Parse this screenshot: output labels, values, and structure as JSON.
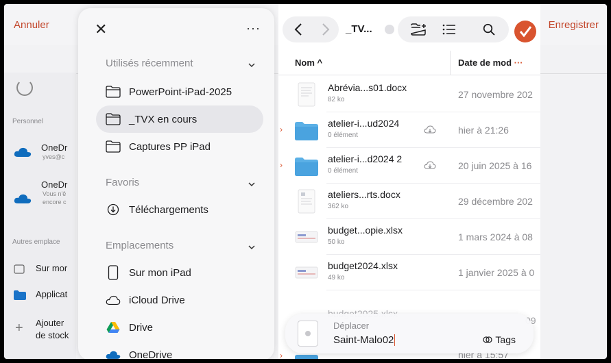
{
  "background": {
    "cancel_label": "Annuler",
    "save_label": "Enregistrer",
    "personal_section": "Personnel",
    "onedrive1_label": "OneDr",
    "onedrive1_sub": "yves@c",
    "onedrive2_label": "OneDr",
    "onedrive2_sub1": "Vous n'ê",
    "onedrive2_sub2": "encore c",
    "other_section": "Autres emplace",
    "item_ipad": "Sur mor",
    "item_applic": "Applicat",
    "item_add1": "Ajouter",
    "item_add2": "de stock"
  },
  "sidebar": {
    "more_label": "···",
    "recent_title": "Utilisés récemment",
    "recent": [
      {
        "label": "PowerPoint-iPad-2025"
      },
      {
        "label": "_TVX en cours"
      },
      {
        "label": "Captures PP iPad"
      }
    ],
    "favorites_title": "Favoris",
    "favorites": [
      {
        "label": "Téléchargements"
      }
    ],
    "locations_title": "Emplacements",
    "locations": [
      {
        "label": "Sur mon iPad"
      },
      {
        "label": "iCloud Drive"
      },
      {
        "label": "Drive"
      },
      {
        "label": "OneDrive"
      }
    ]
  },
  "toolbar": {
    "title": "_TV..."
  },
  "columns": {
    "name": "Nom",
    "date": "Date de mod",
    "dots": "···"
  },
  "files": [
    {
      "name": "Abrévia...s01.docx",
      "sub": "82 ko",
      "date": "27 novembre 202",
      "kind": "docx"
    },
    {
      "name": "atelier-i...ud2024",
      "sub": "0 élément",
      "date": "hier à 21:26",
      "kind": "folder"
    },
    {
      "name": "atelier-i...d2024 2",
      "sub": "0 élément",
      "date": "20 juin 2025 à 16",
      "kind": "folder"
    },
    {
      "name": "ateliers...rts.docx",
      "sub": "362 ko",
      "date": "29 décembre 202",
      "kind": "docx"
    },
    {
      "name": "budget...opie.xlsx",
      "sub": "50 ko",
      "date": "1 mars 2024 à 08",
      "kind": "xlsx"
    },
    {
      "name": "budget2024.xlsx",
      "sub": "49 ko",
      "date": "1 janvier 2025 à 0",
      "kind": "xlsx"
    }
  ],
  "partial_rows": {
    "behind_name": "budget2025.xlsx",
    "behind_date": "09",
    "last_date": "hier à 15:57"
  },
  "savebar": {
    "move_label": "Déplacer",
    "filename": "Saint-Malo02",
    "tags_label": "Tags"
  },
  "colors": {
    "accent": "#d9542f",
    "folder": "#4aa3df"
  }
}
